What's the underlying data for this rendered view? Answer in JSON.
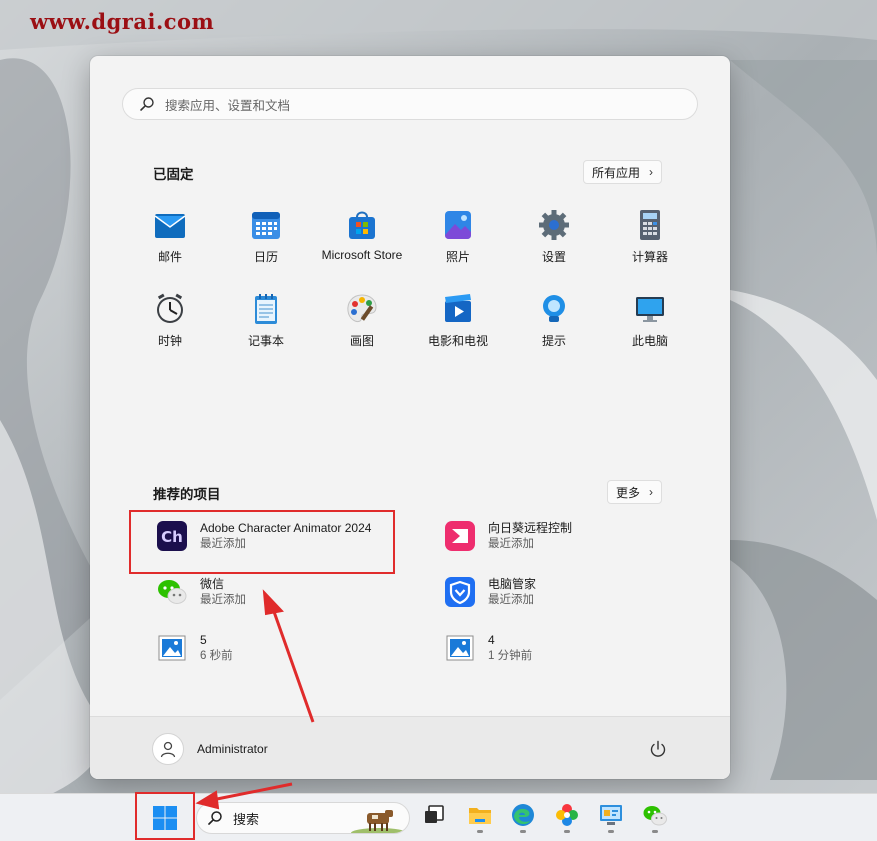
{
  "watermark": "www.dgrai.com",
  "start_menu": {
    "search_placeholder": "搜索应用、设置和文档",
    "pinned": {
      "title": "已固定",
      "all_apps_label": "所有应用",
      "apps": [
        {
          "label": "邮件",
          "icon": "mail-icon"
        },
        {
          "label": "日历",
          "icon": "calendar-icon"
        },
        {
          "label": "Microsoft Store",
          "icon": "store-icon"
        },
        {
          "label": "照片",
          "icon": "photos-icon"
        },
        {
          "label": "设置",
          "icon": "settings-icon"
        },
        {
          "label": "计算器",
          "icon": "calculator-icon"
        },
        {
          "label": "时钟",
          "icon": "clock-icon"
        },
        {
          "label": "记事本",
          "icon": "notepad-icon"
        },
        {
          "label": "画图",
          "icon": "paint-icon"
        },
        {
          "label": "电影和电视",
          "icon": "movies-icon"
        },
        {
          "label": "提示",
          "icon": "tips-icon"
        },
        {
          "label": "此电脑",
          "icon": "this-pc-icon"
        }
      ]
    },
    "recommended": {
      "title": "推荐的项目",
      "more_label": "更多",
      "items": [
        {
          "title": "Adobe Character Animator 2024",
          "subtitle": "最近添加",
          "icon": "character-animator-icon"
        },
        {
          "title": "向日葵远程控制",
          "subtitle": "最近添加",
          "icon": "sunlogin-icon"
        },
        {
          "title": "微信",
          "subtitle": "最近添加",
          "icon": "wechat-icon"
        },
        {
          "title": "电脑管家",
          "subtitle": "最近添加",
          "icon": "pc-manager-icon"
        },
        {
          "title": "5",
          "subtitle": "6 秒前",
          "icon": "image-file-icon"
        },
        {
          "title": "4",
          "subtitle": "1 分钟前",
          "icon": "image-file-icon"
        }
      ]
    },
    "user": {
      "name": "Administrator"
    }
  },
  "taskbar": {
    "search_label": "搜索",
    "apps": [
      "task-view-icon",
      "file-explorer-icon",
      "edge-icon",
      "photo-app-icon",
      "control-panel-icon",
      "wechat-icon"
    ]
  },
  "colors": {
    "highlight": "#e02b2b",
    "accent": "#0078d4"
  }
}
